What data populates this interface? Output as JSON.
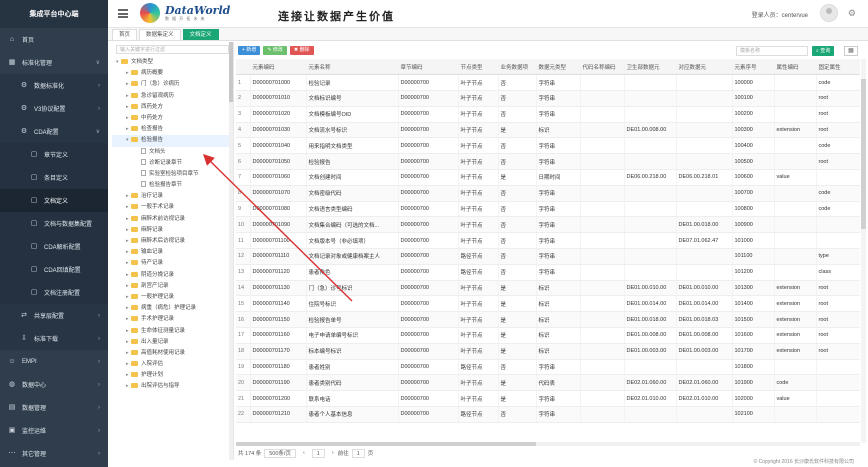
{
  "app": {
    "brand": "集成平台中心端",
    "logo_name": "DataWorld",
    "logo_sub": "数 据 开 拓 未 来",
    "slogan": "连接让数据产生价值",
    "login_label": "登录人员：",
    "login_user": "centervue"
  },
  "sidebar": [
    {
      "label": "首页",
      "icon": "home-icon",
      "level": 0
    },
    {
      "label": "标准化管理",
      "icon": "grid-icon",
      "level": 0,
      "caret": "∨"
    },
    {
      "label": "数据标准化",
      "icon": "gear-icon",
      "level": 1,
      "caret": "›"
    },
    {
      "label": "V3协议配置",
      "icon": "gear-icon",
      "level": 1,
      "caret": "›"
    },
    {
      "label": "CDA配置",
      "icon": "gear-icon",
      "level": 1,
      "caret": "∨"
    },
    {
      "label": "章节定义",
      "icon": "doc-icon",
      "level": 2
    },
    {
      "label": "条目定义",
      "icon": "doc-icon",
      "level": 2
    },
    {
      "label": "文档定义",
      "icon": "doc-icon",
      "level": 2,
      "active": true
    },
    {
      "label": "文档与数据集配置",
      "icon": "doc-icon",
      "level": 2
    },
    {
      "label": "CDA解析配置",
      "icon": "doc-icon",
      "level": 2
    },
    {
      "label": "CDA回填配置",
      "icon": "doc-icon",
      "level": 2
    },
    {
      "label": "文档注册配置",
      "icon": "doc-icon",
      "level": 2
    },
    {
      "label": "共享层配置",
      "icon": "share-icon",
      "level": 1,
      "caret": "›"
    },
    {
      "label": "标准下载",
      "icon": "download-icon",
      "level": 1,
      "caret": "›"
    },
    {
      "label": "EMPI",
      "icon": "user-icon",
      "level": 0,
      "caret": "›"
    },
    {
      "label": "数据中心",
      "icon": "database-icon",
      "level": 0,
      "caret": "›"
    },
    {
      "label": "数据管理",
      "icon": "folder-icon",
      "level": 0,
      "caret": "›"
    },
    {
      "label": "监控运维",
      "icon": "monitor-icon",
      "level": 0,
      "caret": "›"
    },
    {
      "label": "其它管理",
      "icon": "more-icon",
      "level": 0,
      "caret": "›"
    }
  ],
  "tabs": [
    {
      "label": "首页",
      "active": false
    },
    {
      "label": "数据集定义",
      "active": false
    },
    {
      "label": "文档定义",
      "active": true
    }
  ],
  "tree": {
    "search_placeholder": "输入关键字进行过滤",
    "nodes": [
      {
        "label": "文档类型",
        "level": 0,
        "kind": "folder",
        "toggle": "▾"
      },
      {
        "label": "病历概要",
        "level": 1,
        "kind": "folder",
        "toggle": "▸"
      },
      {
        "label": "门（急）诊病历",
        "level": 1,
        "kind": "folder",
        "toggle": "▸"
      },
      {
        "label": "急诊留观病历",
        "level": 1,
        "kind": "folder",
        "toggle": "▸"
      },
      {
        "label": "西药处方",
        "level": 1,
        "kind": "folder",
        "toggle": "▸"
      },
      {
        "label": "中药处方",
        "level": 1,
        "kind": "folder",
        "toggle": "▸"
      },
      {
        "label": "检查报告",
        "level": 1,
        "kind": "folder",
        "toggle": "▸"
      },
      {
        "label": "检验报告",
        "level": 1,
        "kind": "folder",
        "toggle": "▾",
        "selected": true
      },
      {
        "label": "文档头",
        "level": 2,
        "kind": "doc"
      },
      {
        "label": "诊断记录章节",
        "level": 2,
        "kind": "doc"
      },
      {
        "label": "实验室检验项目章节",
        "level": 2,
        "kind": "doc"
      },
      {
        "label": "检验报告章节",
        "level": 2,
        "kind": "doc"
      },
      {
        "label": "治疗记录",
        "level": 1,
        "kind": "folder",
        "toggle": "▸"
      },
      {
        "label": "一般手术记录",
        "level": 1,
        "kind": "folder",
        "toggle": "▸"
      },
      {
        "label": "麻醉术前访视记录",
        "level": 1,
        "kind": "folder",
        "toggle": "▸"
      },
      {
        "label": "麻醉记录",
        "level": 1,
        "kind": "folder",
        "toggle": "▸"
      },
      {
        "label": "麻醉术后访视记录",
        "level": 1,
        "kind": "folder",
        "toggle": "▸"
      },
      {
        "label": "输血记录",
        "level": 1,
        "kind": "folder",
        "toggle": "▸"
      },
      {
        "label": "待产记录",
        "level": 1,
        "kind": "folder",
        "toggle": "▸"
      },
      {
        "label": "阴道分娩记录",
        "level": 1,
        "kind": "folder",
        "toggle": "▸"
      },
      {
        "label": "剖宫产记录",
        "level": 1,
        "kind": "folder",
        "toggle": "▸"
      },
      {
        "label": "一般护理记录",
        "level": 1,
        "kind": "folder",
        "toggle": "▸"
      },
      {
        "label": "病重（病危）护理记录",
        "level": 1,
        "kind": "folder",
        "toggle": "▸"
      },
      {
        "label": "手术护理记录",
        "level": 1,
        "kind": "folder",
        "toggle": "▸"
      },
      {
        "label": "生命体征测量记录",
        "level": 1,
        "kind": "folder",
        "toggle": "▸"
      },
      {
        "label": "出入量记录",
        "level": 1,
        "kind": "folder",
        "toggle": "▸"
      },
      {
        "label": "高值耗材使用记录",
        "level": 1,
        "kind": "folder",
        "toggle": "▸"
      },
      {
        "label": "入院评估",
        "level": 1,
        "kind": "folder",
        "toggle": "▸"
      },
      {
        "label": "护理计划",
        "level": 1,
        "kind": "folder",
        "toggle": "▸"
      },
      {
        "label": "出院评估与指导",
        "level": 1,
        "kind": "folder",
        "toggle": "▸"
      }
    ]
  },
  "toolbar": {
    "add": "+ 新增",
    "edit": "✎ 修改",
    "del": "✖ 删除",
    "search_placeholder": "模板名称",
    "search_btn": "⌕ 查询",
    "view_btn": "▦"
  },
  "table": {
    "columns": [
      "",
      "元素编码",
      "元素名称",
      "章节编码",
      "节点类型",
      "业务数据项",
      "数据元类型",
      "代码名称编码",
      "卫生部数据元",
      "对应数据元",
      "元素序号",
      "属性编码",
      "固定属性"
    ],
    "rows": [
      [
        "1",
        "D00000701000",
        "检验记录",
        "D00000700",
        "叶子节点",
        "否",
        "字符串",
        "",
        "",
        "",
        "100000",
        "",
        "code"
      ],
      [
        "2",
        "D00000701010",
        "文档标识编号",
        "D00000700",
        "叶子节点",
        "否",
        "字符串",
        "",
        "",
        "",
        "100100",
        "",
        "root"
      ],
      [
        "3",
        "D00000701020",
        "文档模板编号OID",
        "D00000700",
        "叶子节点",
        "否",
        "字符串",
        "",
        "",
        "",
        "100200",
        "",
        "root"
      ],
      [
        "4",
        "D00000701030",
        "文档流水号标识",
        "D00000700",
        "叶子节点",
        "是",
        "标识",
        "",
        "DE01.00.008.00",
        "",
        "100300",
        "extension",
        "root"
      ],
      [
        "5",
        "D00000701040",
        "用来指明文档类型",
        "D00000700",
        "叶子节点",
        "否",
        "字符串",
        "",
        "",
        "",
        "100400",
        "",
        "code"
      ],
      [
        "6",
        "D00000701050",
        "检验报告",
        "D00000700",
        "叶子节点",
        "否",
        "字符串",
        "",
        "",
        "",
        "100500",
        "",
        "root"
      ],
      [
        "7",
        "D00000701060",
        "文档创建时间",
        "D00000700",
        "叶子节点",
        "是",
        "日期时间",
        "",
        "DE06.00.218.00",
        "DE06.00.218.01",
        "100600",
        "value",
        ""
      ],
      [
        "8",
        "D00000701070",
        "文档密级代码",
        "D00000700",
        "叶子节点",
        "否",
        "字符串",
        "",
        "",
        "",
        "100700",
        "",
        "code"
      ],
      [
        "9",
        "D00000701080",
        "文档语言类型编码",
        "D00000700",
        "叶子节点",
        "否",
        "字符串",
        "",
        "",
        "",
        "100800",
        "",
        "code"
      ],
      [
        "10",
        "D00000701090",
        "文档集合编码（可选的文档...",
        "D00000700",
        "叶子节点",
        "否",
        "字符串",
        "",
        "",
        "DE01.00.018.00",
        "100900",
        "",
        ""
      ],
      [
        "11",
        "D00000701100",
        "文档版本号（非必填项）",
        "D00000700",
        "叶子节点",
        "否",
        "字符串",
        "",
        "",
        "DE07.01.062.47",
        "101000",
        "",
        ""
      ],
      [
        "12",
        "D00000701110",
        "文档记录对象或健康档案主人",
        "D00000700",
        "路径节点",
        "否",
        "字符串",
        "",
        "",
        "",
        "101100",
        "",
        "type"
      ],
      [
        "13",
        "D00000701120",
        "患者角色",
        "D00000700",
        "路径节点",
        "否",
        "字符串",
        "",
        "",
        "",
        "101200",
        "",
        "class"
      ],
      [
        "14",
        "D00000701130",
        "门（急）诊号标识",
        "D00000700",
        "叶子节点",
        "是",
        "标识",
        "",
        "DE01.00.010.00",
        "DE01.00.010.00",
        "101300",
        "extension",
        "root"
      ],
      [
        "15",
        "D00000701140",
        "住院号标识",
        "D00000700",
        "叶子节点",
        "是",
        "标识",
        "",
        "DE01.00.014.00",
        "DE01.00.014.00",
        "101400",
        "extension",
        "root"
      ],
      [
        "16",
        "D00000701150",
        "检验报告单号",
        "D00000700",
        "叶子节点",
        "是",
        "标识",
        "",
        "DE01.00.018.00",
        "DE01.00.018.03",
        "101500",
        "extension",
        "root"
      ],
      [
        "17",
        "D00000701160",
        "电子申请单编号标识",
        "D00000700",
        "叶子节点",
        "是",
        "标识",
        "",
        "DE01.00.008.00",
        "DE01.00.008.00",
        "101600",
        "extension",
        "root"
      ],
      [
        "18",
        "D00000701170",
        "标本编号标识",
        "D00000700",
        "叶子节点",
        "是",
        "标识",
        "",
        "DE01.00.003.00",
        "DE01.00.003.00",
        "101700",
        "extension",
        "root"
      ],
      [
        "19",
        "D00000701180",
        "患者姓别",
        "D00000700",
        "路径节点",
        "否",
        "字符串",
        "",
        "",
        "",
        "101800",
        "",
        ""
      ],
      [
        "20",
        "D00000701190",
        "患者类别代码",
        "D00000700",
        "叶子节点",
        "是",
        "代码表",
        "",
        "DE02.01.060.00",
        "DE02.01.060.00",
        "101900",
        "code",
        ""
      ],
      [
        "21",
        "D00000701200",
        "联系电话",
        "D00000700",
        "叶子节点",
        "是",
        "字符串",
        "",
        "DE02.01.010.00",
        "DE02.01.010.00",
        "102000",
        "value",
        ""
      ],
      [
        "22",
        "D00000701210",
        "患者个人基本信息",
        "D00000700",
        "路径节点",
        "否",
        "字符串",
        "",
        "",
        "",
        "102100",
        "",
        ""
      ]
    ]
  },
  "pager": {
    "total": "共 174 条",
    "page_size": "500条/页",
    "prev": "‹",
    "page": "1",
    "next": "›",
    "goto_label": "前往",
    "goto_value": "1",
    "goto_unit": "页"
  },
  "footer": {
    "copyright": "© Copyright 2016 长沙康氏软件科技有限公司"
  }
}
